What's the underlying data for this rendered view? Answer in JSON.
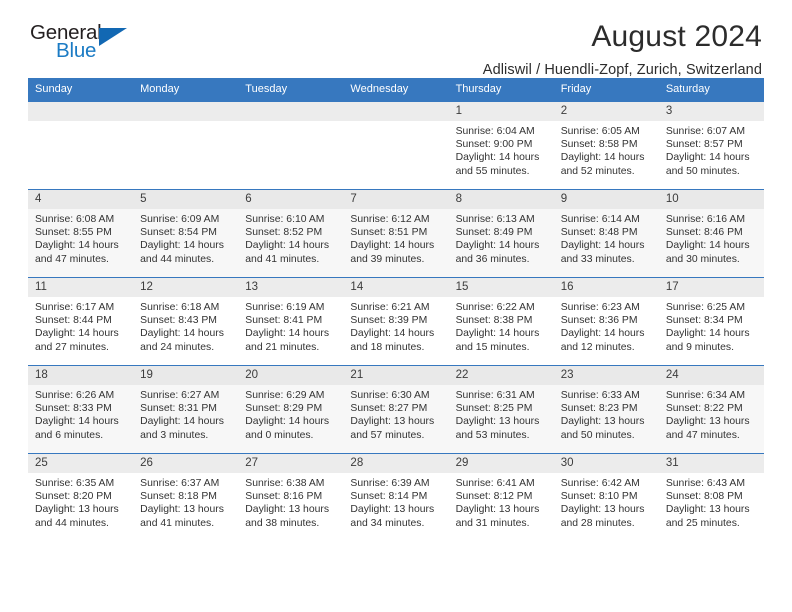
{
  "brand": {
    "name_part1": "General",
    "name_part2": "Blue",
    "triangle_icon": "brand-triangle-icon",
    "color_dark": "#231f20",
    "color_blue": "#1b7bc4"
  },
  "header": {
    "title": "August 2024",
    "subtitle": "Adliswil / Huendli-Zopf, Zurich, Switzerland"
  },
  "theme": {
    "header_blue": "#3778bf",
    "daynum_band": "#ececec",
    "row_alt": "#f7f7f7"
  },
  "weekdays": [
    "Sunday",
    "Monday",
    "Tuesday",
    "Wednesday",
    "Thursday",
    "Friday",
    "Saturday"
  ],
  "weeks": [
    [
      {
        "day": "",
        "sunrise": "",
        "sunset": "",
        "daylight1": "",
        "daylight2": ""
      },
      {
        "day": "",
        "sunrise": "",
        "sunset": "",
        "daylight1": "",
        "daylight2": ""
      },
      {
        "day": "",
        "sunrise": "",
        "sunset": "",
        "daylight1": "",
        "daylight2": ""
      },
      {
        "day": "",
        "sunrise": "",
        "sunset": "",
        "daylight1": "",
        "daylight2": ""
      },
      {
        "day": "1",
        "sunrise": "Sunrise: 6:04 AM",
        "sunset": "Sunset: 9:00 PM",
        "daylight1": "Daylight: 14 hours",
        "daylight2": "and 55 minutes."
      },
      {
        "day": "2",
        "sunrise": "Sunrise: 6:05 AM",
        "sunset": "Sunset: 8:58 PM",
        "daylight1": "Daylight: 14 hours",
        "daylight2": "and 52 minutes."
      },
      {
        "day": "3",
        "sunrise": "Sunrise: 6:07 AM",
        "sunset": "Sunset: 8:57 PM",
        "daylight1": "Daylight: 14 hours",
        "daylight2": "and 50 minutes."
      }
    ],
    [
      {
        "day": "4",
        "sunrise": "Sunrise: 6:08 AM",
        "sunset": "Sunset: 8:55 PM",
        "daylight1": "Daylight: 14 hours",
        "daylight2": "and 47 minutes."
      },
      {
        "day": "5",
        "sunrise": "Sunrise: 6:09 AM",
        "sunset": "Sunset: 8:54 PM",
        "daylight1": "Daylight: 14 hours",
        "daylight2": "and 44 minutes."
      },
      {
        "day": "6",
        "sunrise": "Sunrise: 6:10 AM",
        "sunset": "Sunset: 8:52 PM",
        "daylight1": "Daylight: 14 hours",
        "daylight2": "and 41 minutes."
      },
      {
        "day": "7",
        "sunrise": "Sunrise: 6:12 AM",
        "sunset": "Sunset: 8:51 PM",
        "daylight1": "Daylight: 14 hours",
        "daylight2": "and 39 minutes."
      },
      {
        "day": "8",
        "sunrise": "Sunrise: 6:13 AM",
        "sunset": "Sunset: 8:49 PM",
        "daylight1": "Daylight: 14 hours",
        "daylight2": "and 36 minutes."
      },
      {
        "day": "9",
        "sunrise": "Sunrise: 6:14 AM",
        "sunset": "Sunset: 8:48 PM",
        "daylight1": "Daylight: 14 hours",
        "daylight2": "and 33 minutes."
      },
      {
        "day": "10",
        "sunrise": "Sunrise: 6:16 AM",
        "sunset": "Sunset: 8:46 PM",
        "daylight1": "Daylight: 14 hours",
        "daylight2": "and 30 minutes."
      }
    ],
    [
      {
        "day": "11",
        "sunrise": "Sunrise: 6:17 AM",
        "sunset": "Sunset: 8:44 PM",
        "daylight1": "Daylight: 14 hours",
        "daylight2": "and 27 minutes."
      },
      {
        "day": "12",
        "sunrise": "Sunrise: 6:18 AM",
        "sunset": "Sunset: 8:43 PM",
        "daylight1": "Daylight: 14 hours",
        "daylight2": "and 24 minutes."
      },
      {
        "day": "13",
        "sunrise": "Sunrise: 6:19 AM",
        "sunset": "Sunset: 8:41 PM",
        "daylight1": "Daylight: 14 hours",
        "daylight2": "and 21 minutes."
      },
      {
        "day": "14",
        "sunrise": "Sunrise: 6:21 AM",
        "sunset": "Sunset: 8:39 PM",
        "daylight1": "Daylight: 14 hours",
        "daylight2": "and 18 minutes."
      },
      {
        "day": "15",
        "sunrise": "Sunrise: 6:22 AM",
        "sunset": "Sunset: 8:38 PM",
        "daylight1": "Daylight: 14 hours",
        "daylight2": "and 15 minutes."
      },
      {
        "day": "16",
        "sunrise": "Sunrise: 6:23 AM",
        "sunset": "Sunset: 8:36 PM",
        "daylight1": "Daylight: 14 hours",
        "daylight2": "and 12 minutes."
      },
      {
        "day": "17",
        "sunrise": "Sunrise: 6:25 AM",
        "sunset": "Sunset: 8:34 PM",
        "daylight1": "Daylight: 14 hours",
        "daylight2": "and 9 minutes."
      }
    ],
    [
      {
        "day": "18",
        "sunrise": "Sunrise: 6:26 AM",
        "sunset": "Sunset: 8:33 PM",
        "daylight1": "Daylight: 14 hours",
        "daylight2": "and 6 minutes."
      },
      {
        "day": "19",
        "sunrise": "Sunrise: 6:27 AM",
        "sunset": "Sunset: 8:31 PM",
        "daylight1": "Daylight: 14 hours",
        "daylight2": "and 3 minutes."
      },
      {
        "day": "20",
        "sunrise": "Sunrise: 6:29 AM",
        "sunset": "Sunset: 8:29 PM",
        "daylight1": "Daylight: 14 hours",
        "daylight2": "and 0 minutes."
      },
      {
        "day": "21",
        "sunrise": "Sunrise: 6:30 AM",
        "sunset": "Sunset: 8:27 PM",
        "daylight1": "Daylight: 13 hours",
        "daylight2": "and 57 minutes."
      },
      {
        "day": "22",
        "sunrise": "Sunrise: 6:31 AM",
        "sunset": "Sunset: 8:25 PM",
        "daylight1": "Daylight: 13 hours",
        "daylight2": "and 53 minutes."
      },
      {
        "day": "23",
        "sunrise": "Sunrise: 6:33 AM",
        "sunset": "Sunset: 8:23 PM",
        "daylight1": "Daylight: 13 hours",
        "daylight2": "and 50 minutes."
      },
      {
        "day": "24",
        "sunrise": "Sunrise: 6:34 AM",
        "sunset": "Sunset: 8:22 PM",
        "daylight1": "Daylight: 13 hours",
        "daylight2": "and 47 minutes."
      }
    ],
    [
      {
        "day": "25",
        "sunrise": "Sunrise: 6:35 AM",
        "sunset": "Sunset: 8:20 PM",
        "daylight1": "Daylight: 13 hours",
        "daylight2": "and 44 minutes."
      },
      {
        "day": "26",
        "sunrise": "Sunrise: 6:37 AM",
        "sunset": "Sunset: 8:18 PM",
        "daylight1": "Daylight: 13 hours",
        "daylight2": "and 41 minutes."
      },
      {
        "day": "27",
        "sunrise": "Sunrise: 6:38 AM",
        "sunset": "Sunset: 8:16 PM",
        "daylight1": "Daylight: 13 hours",
        "daylight2": "and 38 minutes."
      },
      {
        "day": "28",
        "sunrise": "Sunrise: 6:39 AM",
        "sunset": "Sunset: 8:14 PM",
        "daylight1": "Daylight: 13 hours",
        "daylight2": "and 34 minutes."
      },
      {
        "day": "29",
        "sunrise": "Sunrise: 6:41 AM",
        "sunset": "Sunset: 8:12 PM",
        "daylight1": "Daylight: 13 hours",
        "daylight2": "and 31 minutes."
      },
      {
        "day": "30",
        "sunrise": "Sunrise: 6:42 AM",
        "sunset": "Sunset: 8:10 PM",
        "daylight1": "Daylight: 13 hours",
        "daylight2": "and 28 minutes."
      },
      {
        "day": "31",
        "sunrise": "Sunrise: 6:43 AM",
        "sunset": "Sunset: 8:08 PM",
        "daylight1": "Daylight: 13 hours",
        "daylight2": "and 25 minutes."
      }
    ]
  ]
}
